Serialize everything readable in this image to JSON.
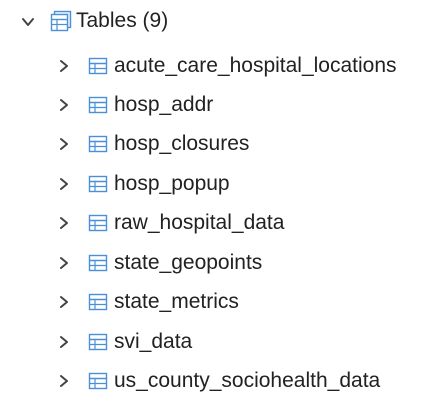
{
  "tree": {
    "group": {
      "label": "Tables (9)",
      "icon": "tables-icon",
      "expanded": true
    },
    "items": [
      {
        "label": "acute_care_hospital_locations",
        "icon": "table-icon"
      },
      {
        "label": "hosp_addr",
        "icon": "table-icon"
      },
      {
        "label": "hosp_closures",
        "icon": "table-icon"
      },
      {
        "label": "hosp_popup",
        "icon": "table-icon"
      },
      {
        "label": "raw_hospital_data",
        "icon": "table-icon"
      },
      {
        "label": "state_geopoints",
        "icon": "table-icon"
      },
      {
        "label": "state_metrics",
        "icon": "table-icon"
      },
      {
        "label": "svi_data",
        "icon": "table-icon"
      },
      {
        "label": "us_county_sociohealth_data",
        "icon": "table-icon"
      }
    ]
  },
  "colors": {
    "text": "#222222",
    "icon_blue": "#4a90d9",
    "chevron": "#444444"
  }
}
